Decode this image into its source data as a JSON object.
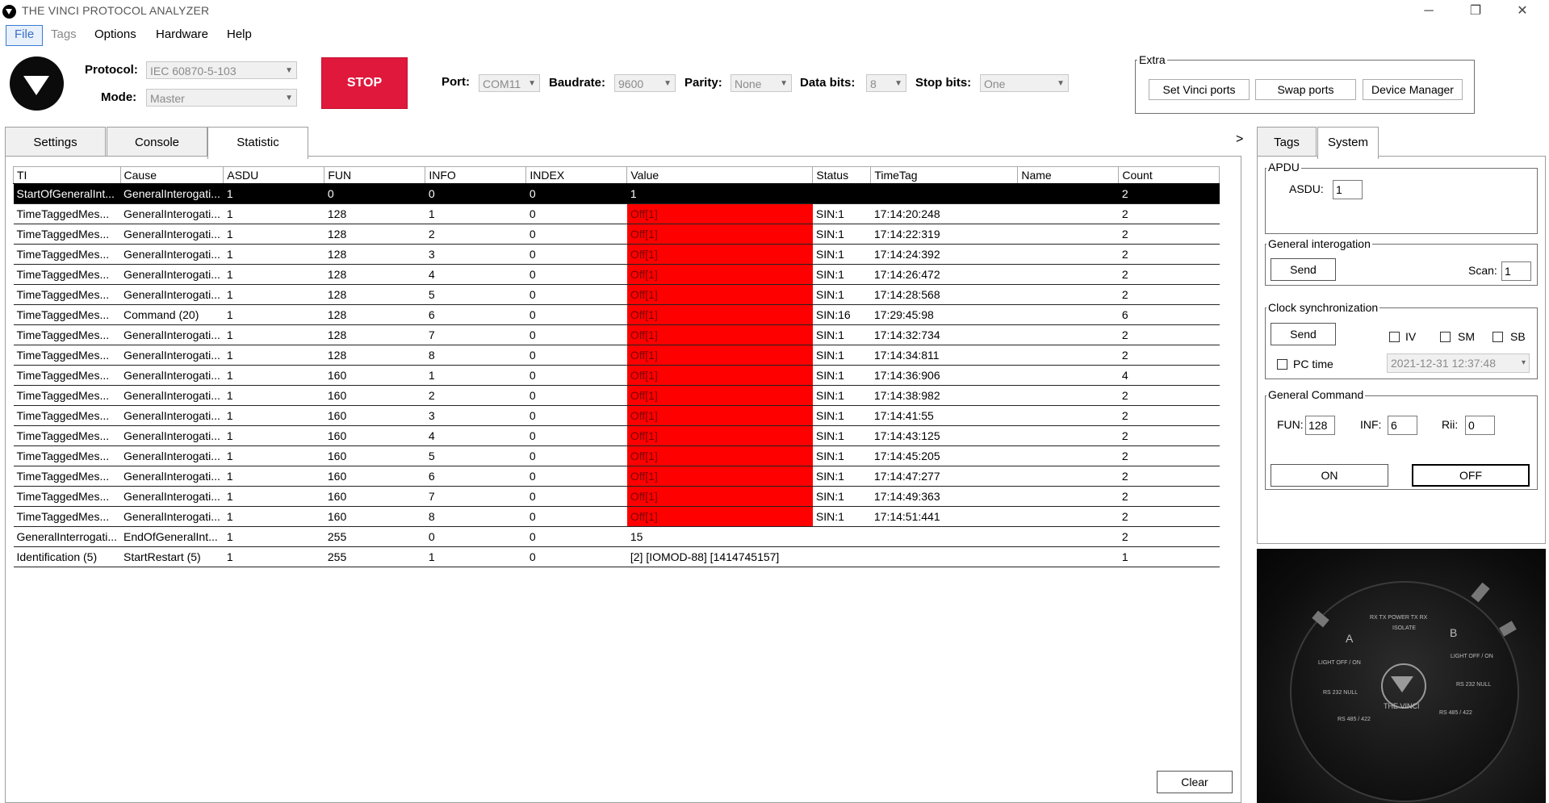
{
  "window": {
    "title": "THE VINCI PROTOCOL ANALYZER",
    "controls": [
      "─",
      "❐",
      "✕"
    ]
  },
  "menu": [
    "File",
    "Tags",
    "Options",
    "Hardware",
    "Help"
  ],
  "toolbar": {
    "protocol_label": "Protocol:",
    "protocol_value": "IEC 60870-5-103",
    "mode_label": "Mode:",
    "mode_value": "Master",
    "stop_label": "STOP",
    "port_label": "Port:",
    "port_value": "COM11",
    "baudrate_label": "Baudrate:",
    "baudrate_value": "9600",
    "parity_label": "Parity:",
    "parity_value": "None",
    "databits_label": "Data bits:",
    "databits_value": "8",
    "stopbits_label": "Stop bits:",
    "stopbits_value": "One"
  },
  "extra": {
    "legend": "Extra",
    "set_ports": "Set Vinci ports",
    "swap_ports": "Swap ports",
    "device_manager": "Device Manager"
  },
  "tabs": [
    "Settings",
    "Console",
    "Statistic"
  ],
  "collapse_arrow": ">",
  "table": {
    "headers": [
      "TI",
      "Cause",
      "ASDU",
      "FUN",
      "INFO",
      "INDEX",
      "Value",
      "Status",
      "TimeTag",
      "Name",
      "Count"
    ],
    "rows": [
      {
        "ti": "StartOfGeneralInt...",
        "cause": "GeneralInterogati...",
        "asdu": "1",
        "fun": "0",
        "info": "0",
        "index": "0",
        "value": "1",
        "status": "",
        "timetag": "",
        "name": "",
        "count": "2"
      },
      {
        "ti": "TimeTaggedMes...",
        "cause": "GeneralInterogati...",
        "asdu": "1",
        "fun": "128",
        "info": "1",
        "index": "0",
        "value": "Off[1]",
        "status": "SIN:1",
        "timetag": "17:14:20:248",
        "name": "",
        "count": "2"
      },
      {
        "ti": "TimeTaggedMes...",
        "cause": "GeneralInterogati...",
        "asdu": "1",
        "fun": "128",
        "info": "2",
        "index": "0",
        "value": "Off[1]",
        "status": "SIN:1",
        "timetag": "17:14:22:319",
        "name": "",
        "count": "2"
      },
      {
        "ti": "TimeTaggedMes...",
        "cause": "GeneralInterogati...",
        "asdu": "1",
        "fun": "128",
        "info": "3",
        "index": "0",
        "value": "Off[1]",
        "status": "SIN:1",
        "timetag": "17:14:24:392",
        "name": "",
        "count": "2"
      },
      {
        "ti": "TimeTaggedMes...",
        "cause": "GeneralInterogati...",
        "asdu": "1",
        "fun": "128",
        "info": "4",
        "index": "0",
        "value": "Off[1]",
        "status": "SIN:1",
        "timetag": "17:14:26:472",
        "name": "",
        "count": "2"
      },
      {
        "ti": "TimeTaggedMes...",
        "cause": "GeneralInterogati...",
        "asdu": "1",
        "fun": "128",
        "info": "5",
        "index": "0",
        "value": "Off[1]",
        "status": "SIN:1",
        "timetag": "17:14:28:568",
        "name": "",
        "count": "2"
      },
      {
        "ti": "TimeTaggedMes...",
        "cause": "Command (20)",
        "asdu": "1",
        "fun": "128",
        "info": "6",
        "index": "0",
        "value": "Off[1]",
        "status": "SIN:16",
        "timetag": "17:29:45:98",
        "name": "",
        "count": "6"
      },
      {
        "ti": "TimeTaggedMes...",
        "cause": "GeneralInterogati...",
        "asdu": "1",
        "fun": "128",
        "info": "7",
        "index": "0",
        "value": "Off[1]",
        "status": "SIN:1",
        "timetag": "17:14:32:734",
        "name": "",
        "count": "2"
      },
      {
        "ti": "TimeTaggedMes...",
        "cause": "GeneralInterogati...",
        "asdu": "1",
        "fun": "128",
        "info": "8",
        "index": "0",
        "value": "Off[1]",
        "status": "SIN:1",
        "timetag": "17:14:34:811",
        "name": "",
        "count": "2"
      },
      {
        "ti": "TimeTaggedMes...",
        "cause": "GeneralInterogati...",
        "asdu": "1",
        "fun": "160",
        "info": "1",
        "index": "0",
        "value": "Off[1]",
        "status": "SIN:1",
        "timetag": "17:14:36:906",
        "name": "",
        "count": "4"
      },
      {
        "ti": "TimeTaggedMes...",
        "cause": "GeneralInterogati...",
        "asdu": "1",
        "fun": "160",
        "info": "2",
        "index": "0",
        "value": "Off[1]",
        "status": "SIN:1",
        "timetag": "17:14:38:982",
        "name": "",
        "count": "2"
      },
      {
        "ti": "TimeTaggedMes...",
        "cause": "GeneralInterogati...",
        "asdu": "1",
        "fun": "160",
        "info": "3",
        "index": "0",
        "value": "Off[1]",
        "status": "SIN:1",
        "timetag": "17:14:41:55",
        "name": "",
        "count": "2"
      },
      {
        "ti": "TimeTaggedMes...",
        "cause": "GeneralInterogati...",
        "asdu": "1",
        "fun": "160",
        "info": "4",
        "index": "0",
        "value": "Off[1]",
        "status": "SIN:1",
        "timetag": "17:14:43:125",
        "name": "",
        "count": "2"
      },
      {
        "ti": "TimeTaggedMes...",
        "cause": "GeneralInterogati...",
        "asdu": "1",
        "fun": "160",
        "info": "5",
        "index": "0",
        "value": "Off[1]",
        "status": "SIN:1",
        "timetag": "17:14:45:205",
        "name": "",
        "count": "2"
      },
      {
        "ti": "TimeTaggedMes...",
        "cause": "GeneralInterogati...",
        "asdu": "1",
        "fun": "160",
        "info": "6",
        "index": "0",
        "value": "Off[1]",
        "status": "SIN:1",
        "timetag": "17:14:47:277",
        "name": "",
        "count": "2"
      },
      {
        "ti": "TimeTaggedMes...",
        "cause": "GeneralInterogati...",
        "asdu": "1",
        "fun": "160",
        "info": "7",
        "index": "0",
        "value": "Off[1]",
        "status": "SIN:1",
        "timetag": "17:14:49:363",
        "name": "",
        "count": "2"
      },
      {
        "ti": "TimeTaggedMes...",
        "cause": "GeneralInterogati...",
        "asdu": "1",
        "fun": "160",
        "info": "8",
        "index": "0",
        "value": "Off[1]",
        "status": "SIN:1",
        "timetag": "17:14:51:441",
        "name": "",
        "count": "2"
      },
      {
        "ti": "GeneralInterrogati...",
        "cause": "EndOfGeneralInt...",
        "asdu": "1",
        "fun": "255",
        "info": "0",
        "index": "0",
        "value": "15",
        "status": "",
        "timetag": "",
        "name": "",
        "count": "2"
      },
      {
        "ti": "Identification (5)",
        "cause": "StartRestart (5)",
        "asdu": "1",
        "fun": "255",
        "info": "1",
        "index": "0",
        "value": "[2] [IOMOD-88] [1414745157]",
        "status": "",
        "timetag": "",
        "name": "",
        "count": "1"
      }
    ]
  },
  "clear_label": "Clear",
  "right_tabs": [
    "Tags",
    "System"
  ],
  "system": {
    "apdu_legend": "APDU",
    "asdu_label": "ASDU:",
    "asdu_value": "1",
    "gi_legend": "General interogation",
    "gi_send": "Send",
    "scan_label": "Scan:",
    "scan_value": "1",
    "clock_legend": "Clock synchronization",
    "clock_send": "Send",
    "iv_label": "IV",
    "sm_label": "SM",
    "sb_label": "SB",
    "pctime_label": "PC time",
    "datetime_value": "2021-12-31 12:37:48",
    "gc_legend": "General Command",
    "fun_label": "FUN:",
    "fun_value": "128",
    "inf_label": "INF:",
    "inf_value": "6",
    "rii_label": "Rii:",
    "rii_value": "0",
    "on_label": "ON",
    "off_label": "OFF"
  },
  "device": {
    "brand": "THE VINCI",
    "port_a": "A",
    "port_b": "B",
    "leds": "RX  TX  POWER  TX  RX",
    "isolate": "ISOLATE",
    "light_a": "LIGHT OFF / ON",
    "light_b": "LIGHT OFF / ON",
    "rs232_a": "RS 232 NULL",
    "rs232_b": "RS 232 NULL",
    "rs485_a": "RS 485 / 422",
    "rs485_b": "RS 485 / 422"
  },
  "colors": {
    "stop": "#e0183c",
    "value_off_bg": "#ff0000",
    "selected_row": "#000000"
  }
}
